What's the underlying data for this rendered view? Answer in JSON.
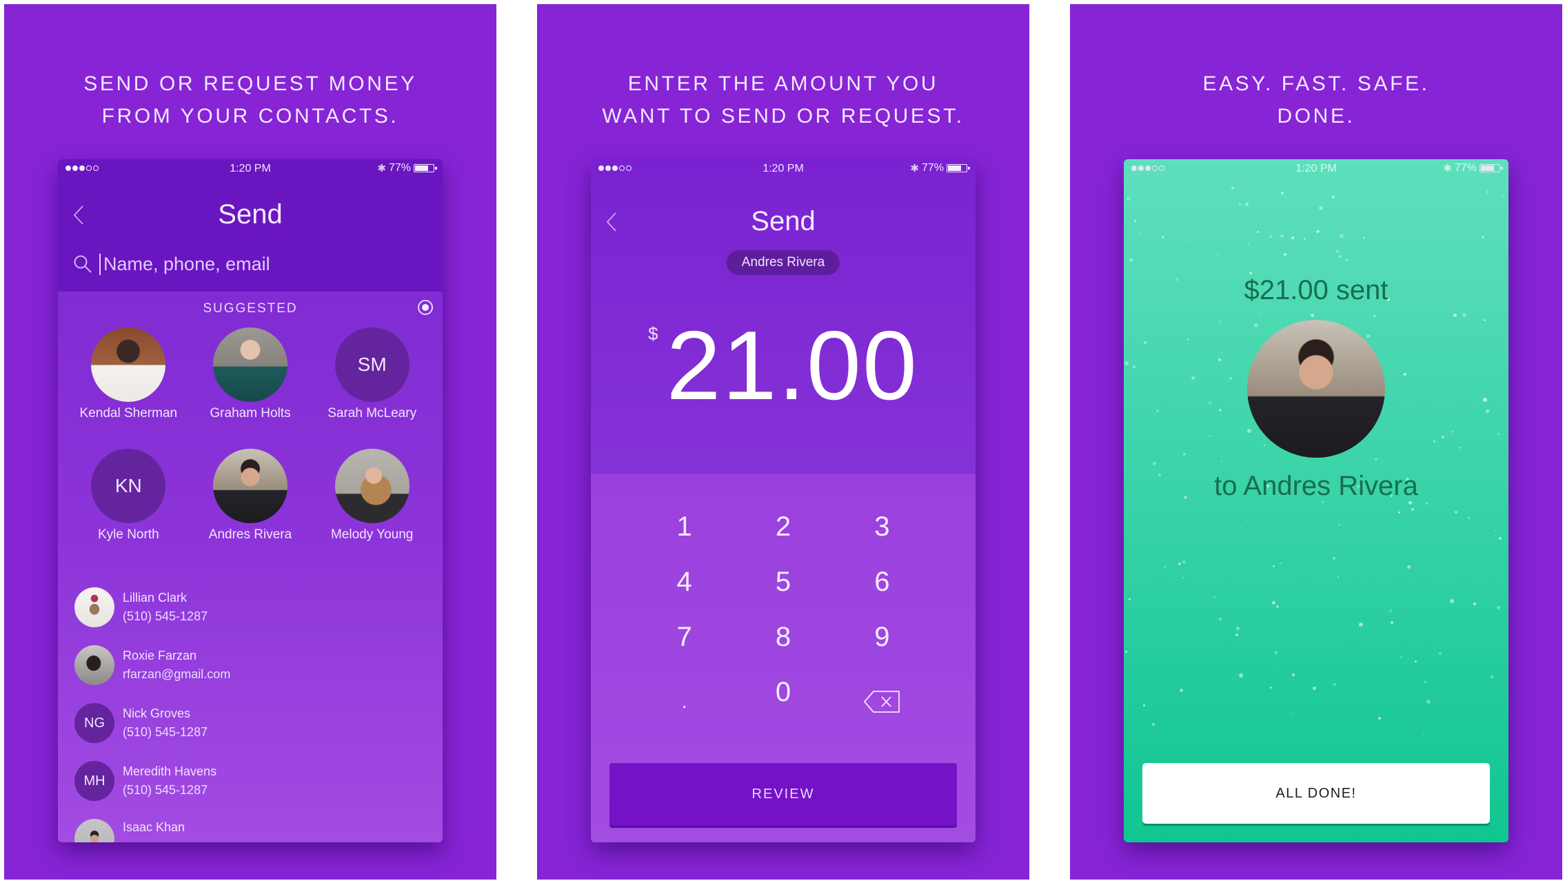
{
  "colors": {
    "panel_bg": "#8624d6",
    "header_purple": "#6a16c0",
    "initials_avatar": "#64249e",
    "review_button": "#7412c6",
    "success_green": "#10c690",
    "success_text": "#166e52"
  },
  "status_bar": {
    "time": "1:20 PM",
    "battery": "77%",
    "battery_level": 0.77,
    "signal_bars_filled": 3,
    "signal_bars_total": 5,
    "bluetooth_icon": "bluetooth-icon"
  },
  "panels": [
    {
      "caption": [
        "SEND OR REQUEST MONEY",
        "FROM YOUR CONTACTS."
      ],
      "screen": {
        "title": "Send",
        "back_icon": "chevron-left-icon",
        "search": {
          "icon": "search-icon",
          "placeholder": "Name, phone, email",
          "value": ""
        },
        "suggested_label": "SUGGESTED",
        "suggested": [
          {
            "name": "Kendal Sherman",
            "avatar": "photo"
          },
          {
            "name": "Graham Holts",
            "avatar": "photo"
          },
          {
            "name": "Sarah McLeary",
            "initials": "SM"
          },
          {
            "name": "Kyle North",
            "initials": "KN"
          },
          {
            "name": "Andres Rivera",
            "avatar": "photo"
          },
          {
            "name": "Melody Young",
            "avatar": "photo"
          }
        ],
        "contacts": [
          {
            "name": "Lillian Clark",
            "detail": "(510) 545-1287",
            "avatar": "photo"
          },
          {
            "name": "Roxie Farzan",
            "detail": "rfarzan@gmail.com",
            "avatar": "photo"
          },
          {
            "name": "Nick Groves",
            "detail": "(510) 545-1287",
            "initials": "NG"
          },
          {
            "name": "Meredith Havens",
            "detail": "(510) 545-1287",
            "initials": "MH"
          },
          {
            "name": "Isaac Khan",
            "detail": "",
            "avatar": "photo"
          }
        ]
      }
    },
    {
      "caption": [
        "ENTER THE AMOUNT YOU",
        "WANT TO SEND OR REQUEST."
      ],
      "screen": {
        "title": "Send",
        "back_icon": "chevron-left-icon",
        "recipient": "Andres Rivera",
        "currency_symbol": "$",
        "amount": "21.00",
        "keys": [
          "1",
          "2",
          "3",
          "4",
          "5",
          "6",
          "7",
          "8",
          "9",
          ".",
          "0"
        ],
        "backspace_icon": "backspace-icon",
        "review_label": "REVIEW"
      }
    },
    {
      "caption": [
        "EASY. FAST. SAFE.",
        "DONE."
      ],
      "screen": {
        "sent_text": "$21.00 sent",
        "to_text": "to Andres Rivera",
        "done_label": "ALL DONE!"
      }
    }
  ]
}
